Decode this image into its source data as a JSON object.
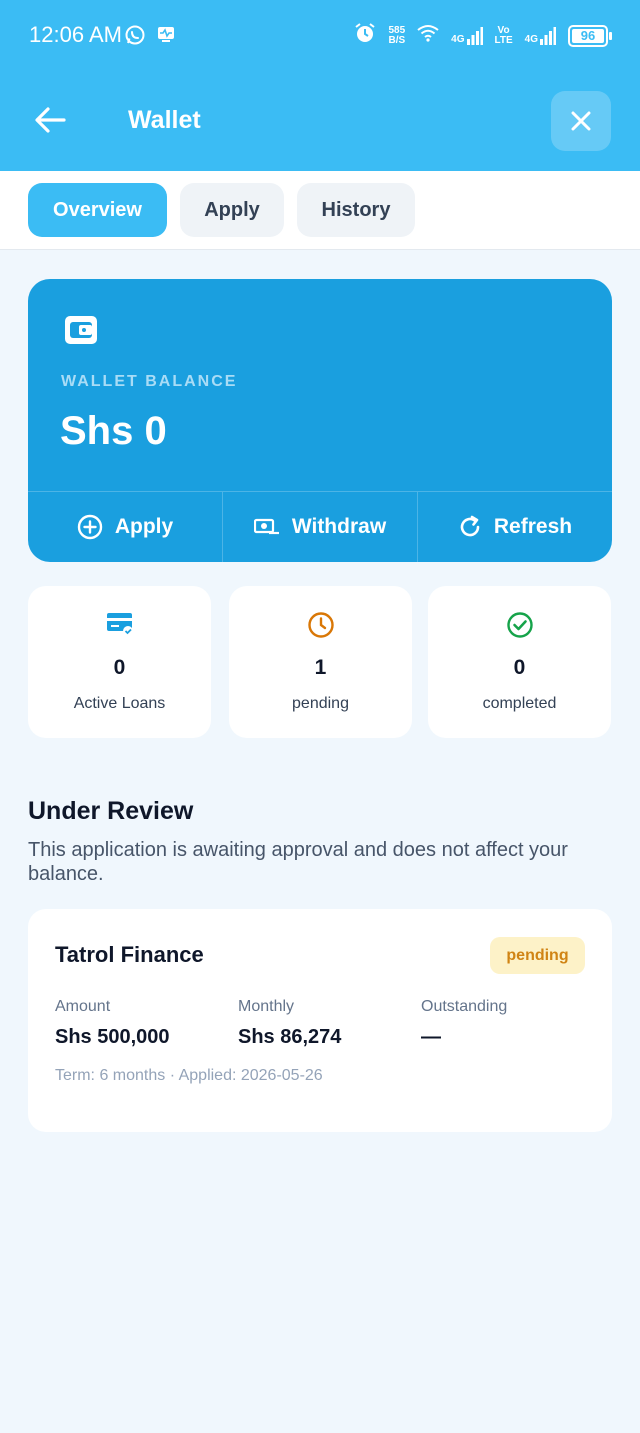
{
  "status_bar": {
    "time": "12:06 AM",
    "net_speed_value": "585",
    "net_speed_unit": "B/S",
    "signal_1": "4G",
    "volte_top": "Vo",
    "volte_bottom": "LTE",
    "signal_2": "4G",
    "battery": "96"
  },
  "header": {
    "title": "Wallet"
  },
  "tabs": [
    {
      "label": "Overview",
      "active": true
    },
    {
      "label": "Apply",
      "active": false
    },
    {
      "label": "History",
      "active": false
    }
  ],
  "balance_card": {
    "label": "WALLET BALANCE",
    "value": "Shs 0",
    "actions": [
      {
        "label": "Apply",
        "icon": "plus-circle-icon"
      },
      {
        "label": "Withdraw",
        "icon": "cash-icon"
      },
      {
        "label": "Refresh",
        "icon": "refresh-icon"
      }
    ]
  },
  "stats": [
    {
      "value": "0",
      "label": "Active Loans",
      "icon": "credit-card-icon",
      "color": "#1a9fdf"
    },
    {
      "value": "1",
      "label": "pending",
      "icon": "clock-icon",
      "color": "#d97706"
    },
    {
      "value": "0",
      "label": "completed",
      "icon": "check-circle-icon",
      "color": "#16a34a"
    }
  ],
  "review": {
    "title": "Under Review",
    "description": "This application is awaiting approval and does not affect your balance.",
    "application": {
      "lender": "Tatrol Finance",
      "status": "pending",
      "amount_label": "Amount",
      "amount_value": "Shs 500,000",
      "monthly_label": "Monthly",
      "monthly_value": "Shs 86,274",
      "outstanding_label": "Outstanding",
      "outstanding_value": "—",
      "meta": "Term: 6 months · Applied: 2026-05-26"
    }
  },
  "colors": {
    "header": "#3bbcf4",
    "card": "#1a9fdf",
    "pending": "#d08414",
    "success": "#16a34a"
  }
}
